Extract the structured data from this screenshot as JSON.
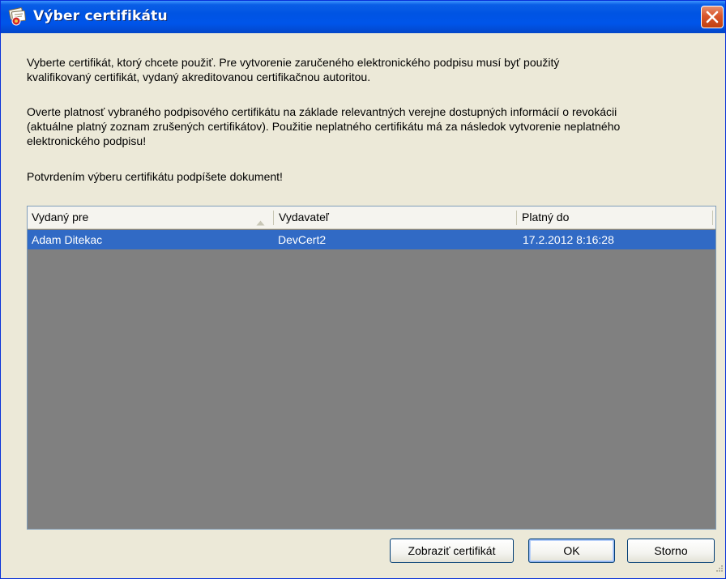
{
  "window": {
    "title": "Výber certifikátu"
  },
  "description": {
    "p1_line1": "Vyberte certifikát, ktorý chcete použiť. Pre vytvorenie zaručeného elektronického podpisu musí byť použitý",
    "p1_line2": "kvalifikovaný certifikát, vydaný akreditovanou certifikačnou autoritou.",
    "p2_line1": "Overte platnosť vybraného podpisového certifikátu na základe relevantných verejne dostupných informácií o revokácii",
    "p2_line2": "(aktuálne platný zoznam zrušených certifikátov). Použitie neplatného certifikátu má za následok vytvorenie neplatného",
    "p2_line3": "elektronického podpisu!",
    "p3": "Potvrdením výberu certifikátu podpíšete dokument!"
  },
  "table": {
    "columns": [
      "Vydaný pre",
      "Vydavateľ",
      "Platný do"
    ],
    "sorted_column": "Vydaný pre",
    "sort_direction": "ascending",
    "rows": [
      {
        "issued_to": "Adam Ditekac",
        "issuer": "DevCert2",
        "valid_to": "17.2.2012 8:16:28",
        "selected": true
      }
    ]
  },
  "buttons": {
    "view_certificate": "Zobraziť certifikát",
    "ok": "OK",
    "cancel": "Storno"
  },
  "colors": {
    "title_bar": "#0054e3",
    "selection": "#316ac5",
    "list_background": "#808080",
    "dialog_background": "#ece9d8",
    "close_button": "#d9552b"
  }
}
